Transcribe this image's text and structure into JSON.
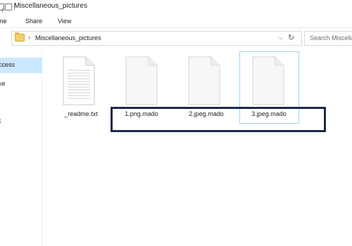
{
  "window": {
    "title": "Miscellaneous_pictures"
  },
  "ribbon": {
    "tabs": [
      "me",
      "Share",
      "View"
    ]
  },
  "address": {
    "chevron": "›",
    "path": "Miscellaneous_pictures",
    "dropdown_glyph": "⌵",
    "refresh_glyph": "↻",
    "up_glyph": "↑"
  },
  "search": {
    "placeholder": "Search Miscella"
  },
  "navpane": {
    "items": [
      "ccess",
      "ve",
      "",
      "k"
    ]
  },
  "files": [
    {
      "name": "_readme.txt",
      "icon": "text-document-icon"
    },
    {
      "name": "1.png.mado",
      "icon": "blank-document-icon"
    },
    {
      "name": "2.jpeg.mado",
      "icon": "blank-document-icon"
    },
    {
      "name": "3.jpeg.mado",
      "icon": "blank-document-icon"
    }
  ],
  "colors": {
    "selection_fill": "#cce8ff",
    "selection_border": "#99d1ff",
    "highlight_border": "#1a2b48",
    "folder": "#f3cf6b"
  }
}
